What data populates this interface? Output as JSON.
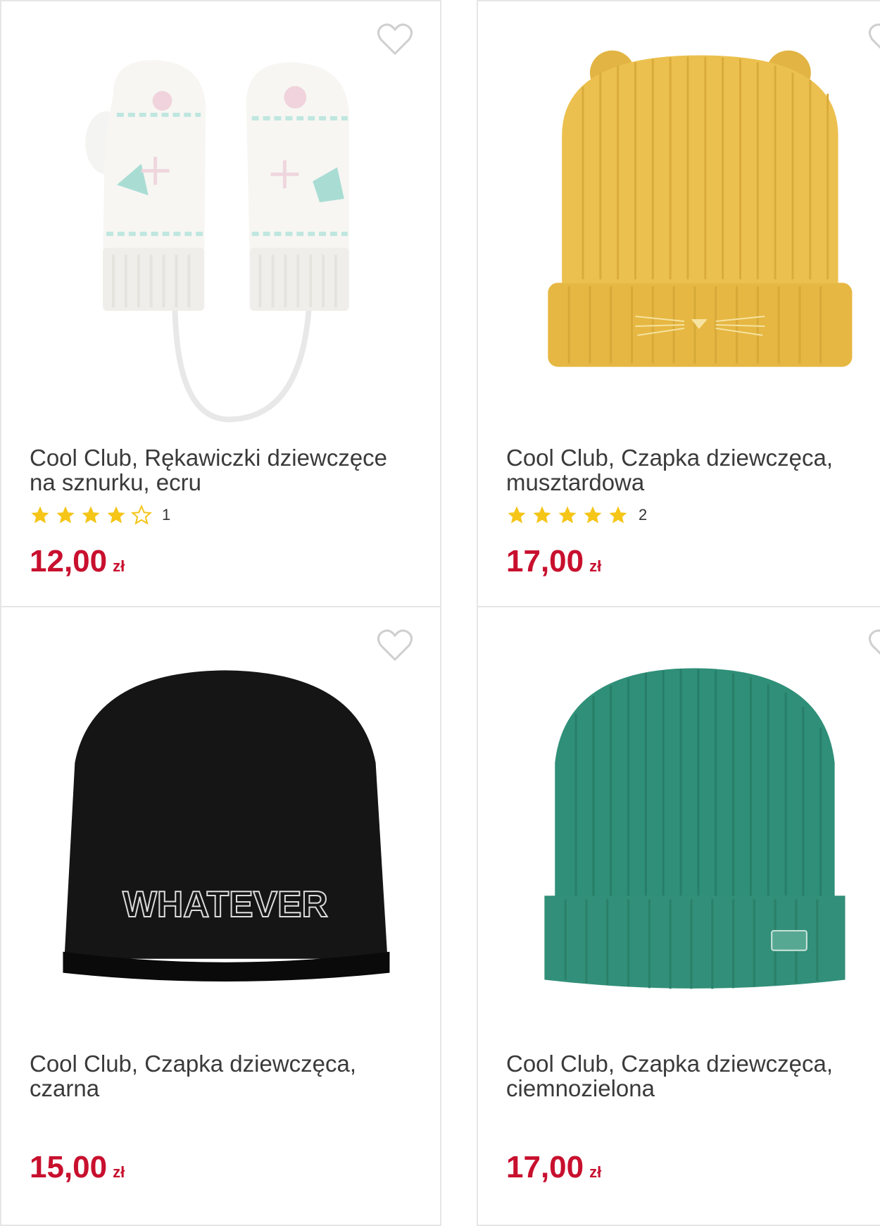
{
  "products": [
    {
      "title": "Cool Club, Rękawiczki dziewczęce na sznurku, ecru",
      "rating": 4,
      "reviews": "1",
      "price": "12,00",
      "currency": "zł"
    },
    {
      "title": "Cool Club, Czapka dziewczęca, musztardowa",
      "rating": 5,
      "reviews": "2",
      "price": "17,00",
      "currency": "zł"
    },
    {
      "title": "Cool Club, Czapka dziewczęca, czarna",
      "price": "15,00",
      "currency": "zł",
      "hat_print": "WHATEVER"
    },
    {
      "title": "Cool Club, Czapka dziewczęca, ciemnozielona",
      "price": "17,00",
      "currency": "zł"
    }
  ],
  "colors": {
    "price": "#c8102e",
    "star": "#f5c518",
    "heart": "#cfcfcf"
  },
  "icons": {
    "favorite": "heart-outline-icon",
    "star": "star-icon"
  }
}
